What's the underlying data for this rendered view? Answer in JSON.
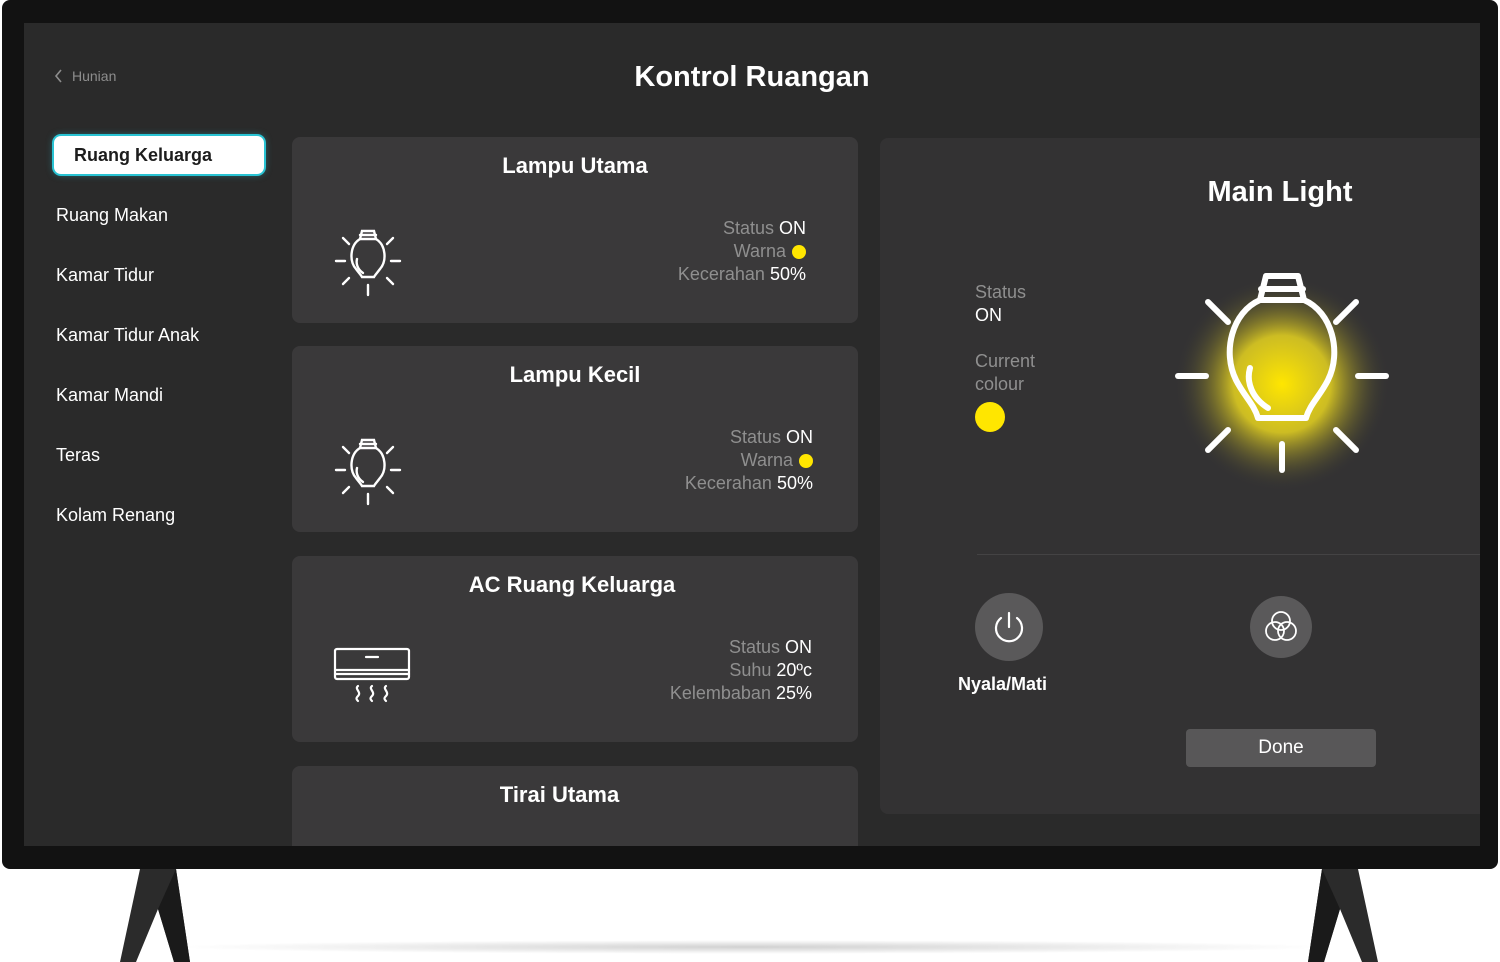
{
  "header": {
    "back_label": "Hunian",
    "title": "Kontrol Ruangan"
  },
  "sidebar": {
    "items": [
      {
        "label": "Ruang Keluarga",
        "active": true
      },
      {
        "label": "Ruang Makan"
      },
      {
        "label": "Kamar Tidur"
      },
      {
        "label": "Kamar Tidur Anak"
      },
      {
        "label": "Kamar Mandi"
      },
      {
        "label": "Teras"
      },
      {
        "label": "Kolam Renang"
      }
    ]
  },
  "devices": [
    {
      "title": "Lampu Utama",
      "icon": "light-bulb-icon",
      "status_label": "Status",
      "status_value": "ON",
      "color_label": "Warna",
      "color": "#ffe600",
      "brightness_label": "Kecerahan",
      "brightness_value": "50%"
    },
    {
      "title": "Lampu Kecil",
      "icon": "light-bulb-icon",
      "status_label": "Status",
      "status_value": "ON",
      "color_label": "Warna",
      "color": "#ffe600",
      "brightness_label": "Kecerahan",
      "brightness_value": "50%"
    },
    {
      "title": "AC Ruang Keluarga",
      "icon": "air-conditioner-icon",
      "status_label": "Status",
      "status_value": "ON",
      "temp_label": "Suhu",
      "temp_value": "20ºc",
      "humidity_label": "Kelembaban",
      "humidity_value": "25%"
    },
    {
      "title": "Tirai Utama"
    }
  ],
  "detail": {
    "title": "Main Light",
    "status_label": "Status",
    "status_value": "ON",
    "colour_label_1": "Current",
    "colour_label_2": "colour",
    "colour": "#ffe600",
    "power_label": "Nyala/Mati",
    "power_icon": "power-icon",
    "colour_icon": "colour-circles-icon",
    "done_label": "Done"
  },
  "colors": {
    "accent": "#29c3d3",
    "bulb_glow": "#ffe600",
    "screen_bg": "#2a2a2a",
    "card_bg": "#3a393a"
  }
}
